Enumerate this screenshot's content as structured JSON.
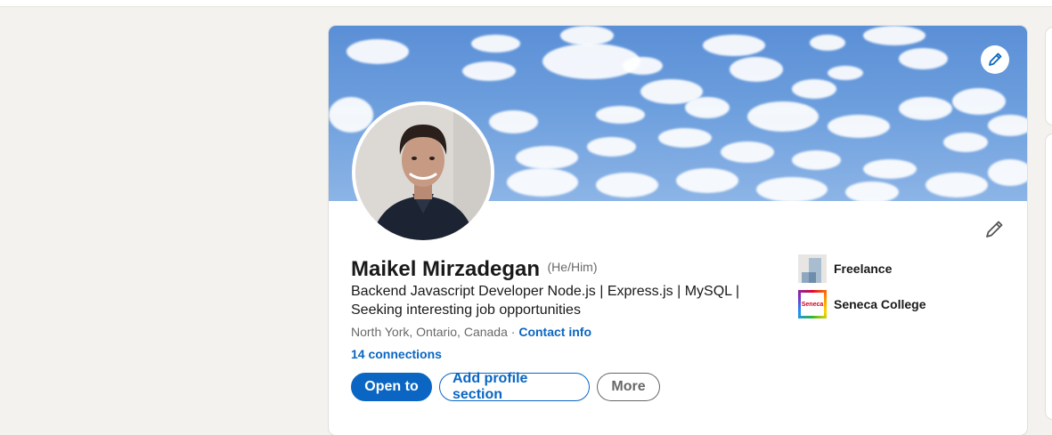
{
  "profile": {
    "name": "Maikel Mirzadegan",
    "pronouns": "(He/Him)",
    "headline": "Backend Javascript Developer Node.js | Express.js | MySQL | Seeking interesting job opportunities",
    "location": "North York, Ontario, Canada",
    "separator": " · ",
    "contact_info": "Contact info",
    "connections": "14 connections"
  },
  "buttons": {
    "open_to": "Open to",
    "add_section": "Add profile section",
    "more": "More"
  },
  "organizations": [
    {
      "name": "Freelance",
      "logo": "freelance-logo"
    },
    {
      "name": "Seneca College",
      "logo": "seneca-logo",
      "logo_text": "Seneca"
    }
  ],
  "icons": {
    "banner_edit": "pencil-icon",
    "intro_edit": "pencil-icon"
  },
  "colors": {
    "accent": "#0a66c2",
    "page_bg": "#f4f2ee",
    "card_bg": "#ffffff"
  }
}
